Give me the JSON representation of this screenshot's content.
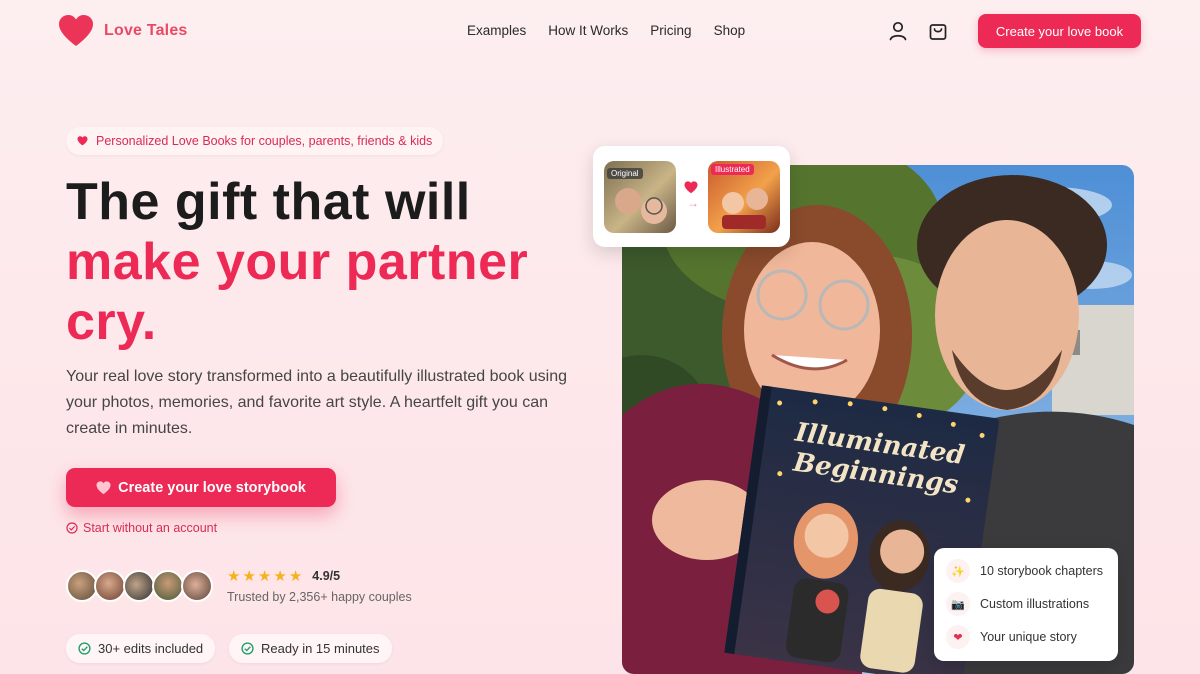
{
  "brand": {
    "name": "Love Tales",
    "color": "#e84a66"
  },
  "nav": {
    "links": [
      "Examples",
      "How It Works",
      "Pricing",
      "Shop"
    ],
    "cta": "Create your love book",
    "icons": [
      "user-icon",
      "cart-icon"
    ]
  },
  "hero": {
    "badge": "Personalized Love Books for couples, parents, friends & kids",
    "headline_1": "The gift that will",
    "headline_2": "make your partner",
    "headline_3": "cry.",
    "subtitle": "Your real love story transformed into a beautifully illustrated book using your photos, memories, and favorite art style. A heartfelt gift you can create in minutes.",
    "cta": "Create your love storybook",
    "secondary_link": "Start without an account",
    "rating": "4.9/5",
    "trusted": "Trusted by 2,356+ happy couples",
    "chips": [
      "30+ edits included",
      "Ready in 15 minutes"
    ]
  },
  "compare": {
    "original_label": "Original",
    "illustrated_label": "Illustrated"
  },
  "book": {
    "title_1": "Illuminated",
    "title_2": "Beginnings"
  },
  "features": [
    {
      "icon": "sparkles-icon",
      "glyph": "✨",
      "label": "10 storybook chapters"
    },
    {
      "icon": "camera-icon",
      "glyph": "📷",
      "label": "Custom illustrations"
    },
    {
      "icon": "heart-icon",
      "glyph": "❤",
      "label": "Your unique story"
    }
  ],
  "colors": {
    "accent": "#ec2a55",
    "star": "#f5b21b",
    "check": "#22a06b"
  }
}
